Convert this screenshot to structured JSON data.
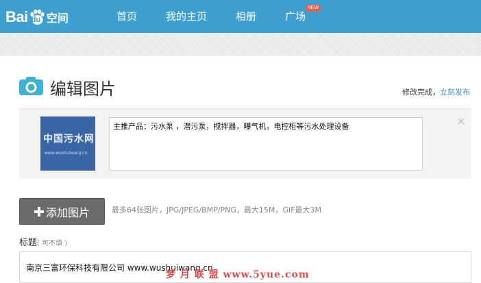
{
  "header": {
    "logo": {
      "bai": "Bai",
      "du": "du",
      "suffix": "空间"
    },
    "nav": [
      {
        "label": "首页"
      },
      {
        "label": "我的主页"
      },
      {
        "label": "相册"
      },
      {
        "label": "广场",
        "badge": "NEW"
      }
    ],
    "accent_color": "#3da0d0"
  },
  "page": {
    "title": "编辑图片",
    "status_text": "修改完成，",
    "publish_link": "立刻发布"
  },
  "image_card": {
    "thumbnail": {
      "title": "中国污水网",
      "url": "www.wushuiwang.cn"
    },
    "caption": "主推产品：污水泵 ，潜污泵，搅拌器，曝气机，电控柜等污水处理设备"
  },
  "upload": {
    "add_button_label": "添加图片",
    "hint": "最多64张图片，JPG/JPEG/BMP/PNG，最大15M，GIF最大3M"
  },
  "title_field": {
    "label": "标题",
    "note": "( 可不填 )",
    "value": "南京三富环保科技有限公司 www.wushuiwang.cn"
  },
  "watermark": "梦 月 联 盟  www.5yue.com"
}
